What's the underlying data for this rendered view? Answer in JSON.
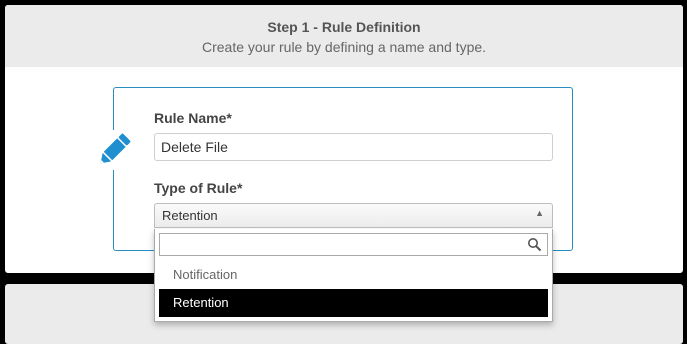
{
  "step": {
    "title": "Step 1 - Rule Definition",
    "subtitle": "Create your rule by defining a name and type."
  },
  "form": {
    "icon": "pencil-icon",
    "accent_color": "#2a8dbf",
    "rule_name": {
      "label": "Rule Name*",
      "value": "Delete File"
    },
    "rule_type": {
      "label": "Type of Rule*",
      "selected": "Retention"
    }
  },
  "dropdown": {
    "search_placeholder": "",
    "options": [
      {
        "label": "Notification",
        "selected": false
      },
      {
        "label": "Retention",
        "selected": true
      }
    ]
  }
}
